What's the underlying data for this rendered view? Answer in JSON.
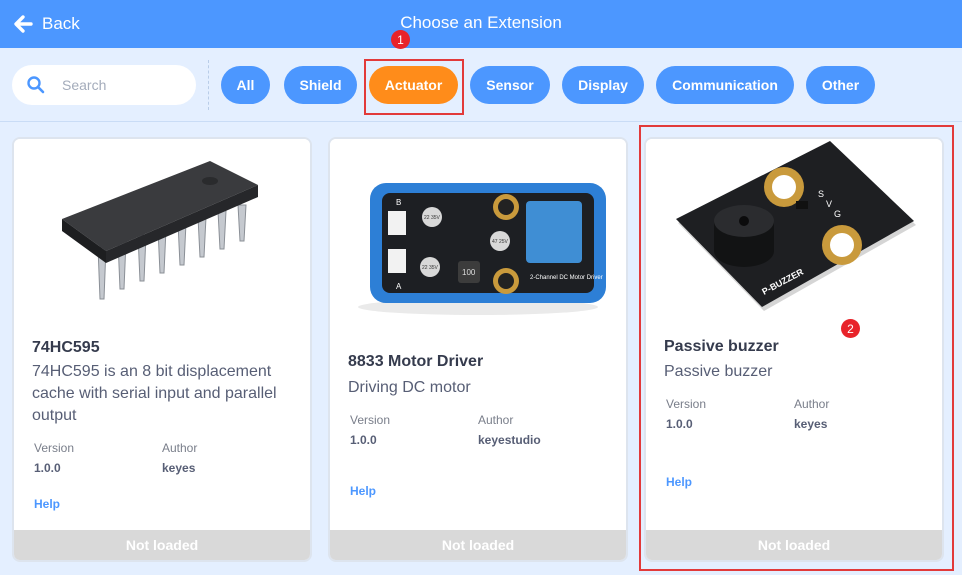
{
  "header": {
    "back_label": "Back",
    "title": "Choose an Extension"
  },
  "search": {
    "placeholder": "Search",
    "value": ""
  },
  "filters": [
    {
      "label": "All"
    },
    {
      "label": "Shield"
    },
    {
      "label": "Actuator",
      "active": true
    },
    {
      "label": "Sensor"
    },
    {
      "label": "Display"
    },
    {
      "label": "Communication"
    },
    {
      "label": "Other"
    }
  ],
  "annotations": {
    "step1": "1",
    "step2": "2"
  },
  "meta_labels": {
    "version": "Version",
    "author": "Author"
  },
  "cards": [
    {
      "name": "74HC595",
      "description": "74HC595 is an 8 bit displacement cache with serial input and parallel output",
      "version": "1.0.0",
      "author": "keyes",
      "help": "Help",
      "status": "Not loaded"
    },
    {
      "name": "8833 Motor Driver",
      "description": "Driving DC motor",
      "version": "1.0.0",
      "author": "keyestudio",
      "help": "Help",
      "status": "Not loaded",
      "image_text": {
        "b": "B",
        "a": "A",
        "module": "2-Channel DC Motor Driver",
        "cap1": "22 35V",
        "cap2": "47 25V",
        "cap3": "22 35V",
        "inductor": "100"
      }
    },
    {
      "name": "Passive buzzer",
      "description": "Passive buzzer",
      "version": "1.0.0",
      "author": "keyes",
      "help": "Help",
      "status": "Not loaded",
      "image_text": {
        "board": "P-BUZZER",
        "pin_s": "S",
        "pin_v": "V",
        "pin_g": "G"
      }
    }
  ],
  "colors": {
    "header": "#4c97ff",
    "chip": "#4c97ff",
    "chip_active": "#ff8c1a",
    "highlight": "#e23a3a"
  }
}
